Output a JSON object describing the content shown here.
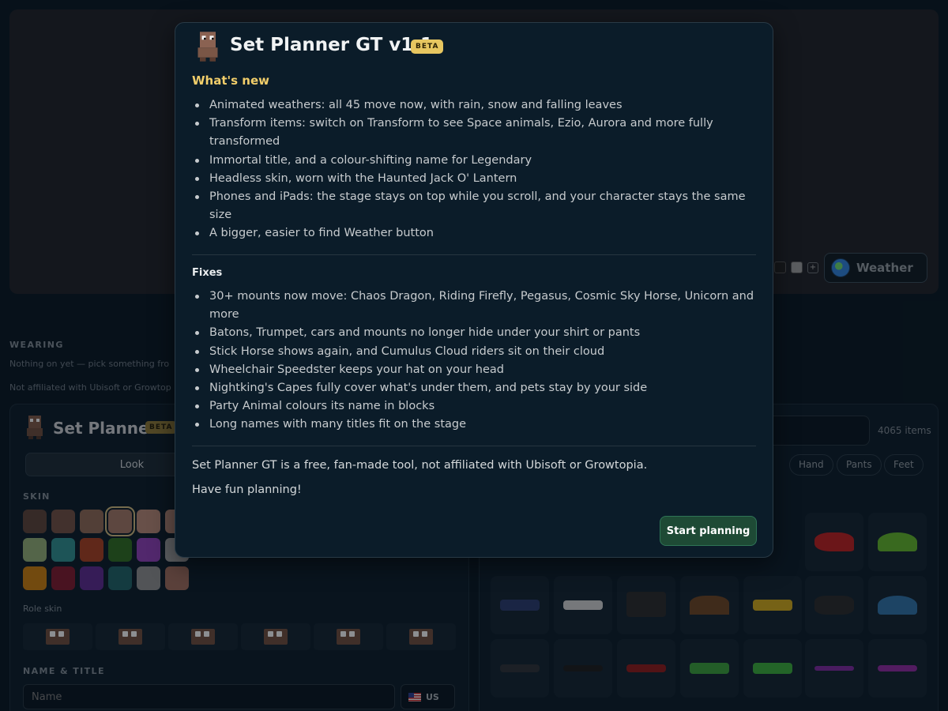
{
  "app": {
    "title": "Set Planner",
    "beta_label": "BETA",
    "weather_label": "Weather",
    "tab_look": "Look",
    "plus_symbol": "+",
    "wearing_heading": "WEARING",
    "wearing_text": "Nothing on yet — pick something fro",
    "affiliation_text": "Not affiliated with Ubisoft or Growtop",
    "skin_heading": "SKIN",
    "role_skin_heading": "Role skin",
    "name_title_heading": "NAME & TITLE",
    "name_placeholder": "Name",
    "language_code": "US",
    "item_count": "4065 items",
    "slot_filters": [
      "Hand",
      "Pants",
      "Feet"
    ],
    "skin_colors": [
      "#5a4238",
      "#6e4f43",
      "#8a6654",
      "#9e7462",
      "#b08472",
      "#a98070",
      "#8ea872",
      "#2f8a8a",
      "#a33f22",
      "#2f6a22",
      "#8a3fb0",
      "#9a9a9a",
      "#c2790e",
      "#7a1a2e",
      "#5a2a8a",
      "#1f5f62",
      "#8a8a8a",
      "#9a6a5a"
    ]
  },
  "modal": {
    "title": "Set Planner GT v1.1",
    "beta_label": "BETA",
    "whats_new_heading": "What's new",
    "whats_new": [
      "Animated weathers: all 45 move now, with rain, snow and falling leaves",
      "Transform items: switch on Transform to see Space animals, Ezio, Aurora and more fully transformed",
      "Immortal title, and a colour-shifting name for Legendary",
      "Headless skin, worn with the Haunted Jack O' Lantern",
      "Phones and iPads: the stage stays on top while you scroll, and your character stays the same size",
      "A bigger, easier to find Weather button"
    ],
    "fixes_heading": "Fixes",
    "fixes": [
      "30+ mounts now move: Chaos Dragon, Riding Firefly, Pegasus, Cosmic Sky Horse, Unicorn and more",
      "Batons, Trumpet, cars and mounts no longer hide under your shirt or pants",
      "Stick Horse shows again, and Cumulus Cloud riders sit on their cloud",
      "Wheelchair Speedster keeps your hat on your head",
      "Nightking's Capes fully cover what's under them, and pets stay by your side",
      "Party Animal colours its name in blocks",
      "Long names with many titles fit on the stage"
    ],
    "note": "Set Planner GT is a free, fan-made tool, not affiliated with Ubisoft or Growtopia.",
    "fun": "Have fun planning!",
    "start_button": "Start planning"
  },
  "colors": {
    "accent_gold": "#f2ce6a",
    "start_button_bg": "#1e4a35",
    "modal_bg": "#0b1c29"
  }
}
